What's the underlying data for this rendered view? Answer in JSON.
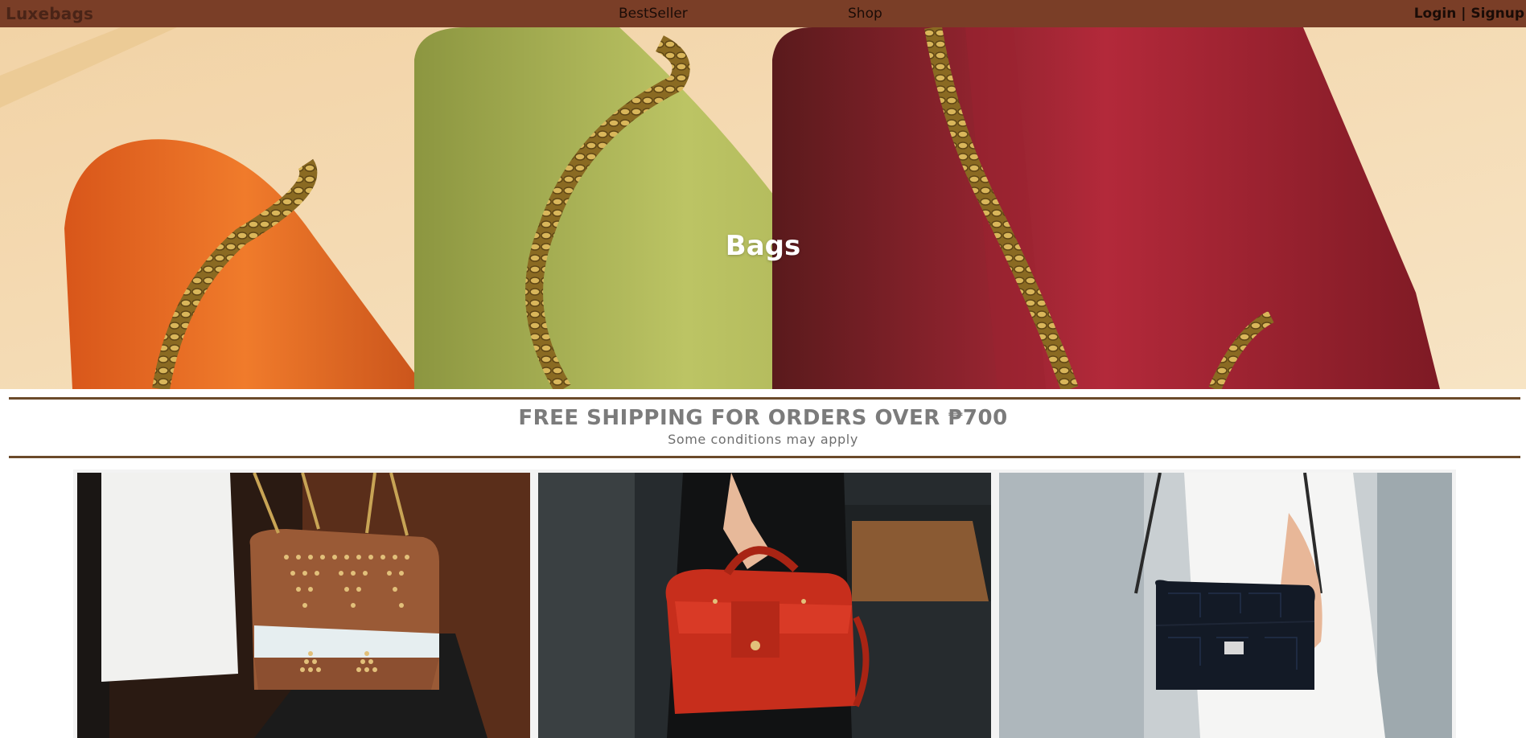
{
  "nav": {
    "brand": "Luxebags",
    "links": [
      "BestSeller",
      "Shop"
    ],
    "login": "Login",
    "separator": "|",
    "signup": "Signup",
    "background": "#7a3e27"
  },
  "hero": {
    "title": "Bags",
    "image": "hero-bags-image"
  },
  "banner": {
    "title": "FREE SHIPPING FOR ORDERS OVER ₱700",
    "subtitle": "Some conditions may apply",
    "rule_color": "#6b4a2a"
  },
  "products": [
    {
      "image": "brown-studded-bag-photo"
    },
    {
      "image": "red-leather-handbag-photo"
    },
    {
      "image": "black-croc-crossbody-photo"
    }
  ]
}
